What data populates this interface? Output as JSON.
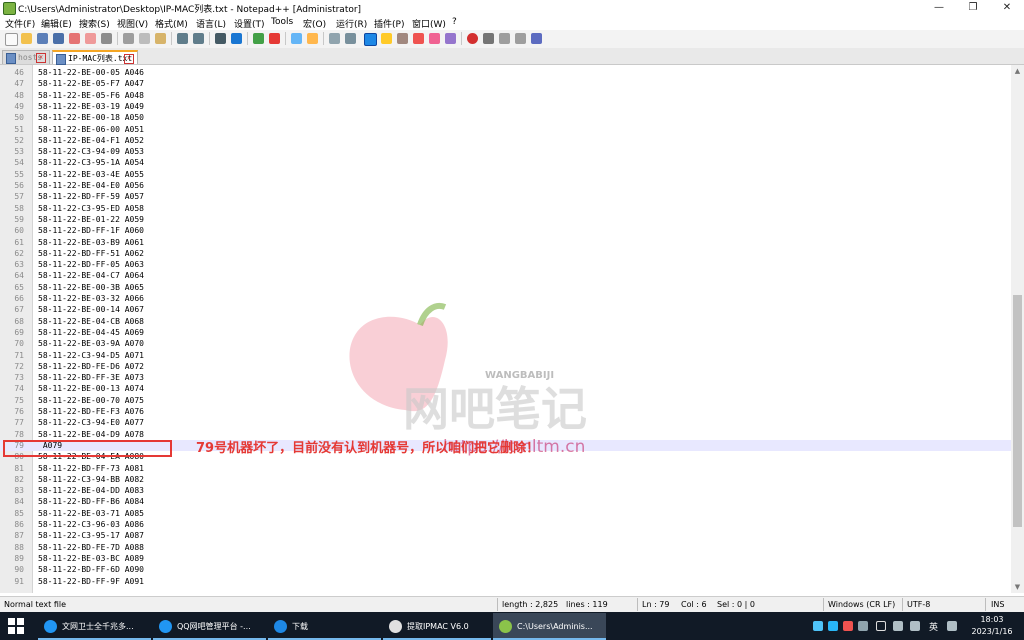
{
  "window": {
    "title": "C:\\Users\\Administrator\\Desktop\\IP-MAC列表.txt - Notepad++ [Administrator]",
    "minimize": "—",
    "maximize": "❐",
    "close": "✕"
  },
  "menu": [
    "文件(F)",
    "编辑(E)",
    "搜索(S)",
    "视图(V)",
    "格式(M)",
    "语言(L)",
    "设置(T)",
    "Tools",
    "宏(O)",
    "运行(R)",
    "插件(P)",
    "窗口(W)",
    "?"
  ],
  "tabs": [
    {
      "label": "hosts"
    },
    {
      "label": "IP-MAC列表.txt"
    }
  ],
  "editor": {
    "lines": [
      {
        "n": "46",
        "text": "58-11-22-BE-00-05 A046"
      },
      {
        "n": "47",
        "text": "58-11-22-BE-05-F7 A047"
      },
      {
        "n": "48",
        "text": "58-11-22-BE-05-F6 A048"
      },
      {
        "n": "49",
        "text": "58-11-22-BE-03-19 A049"
      },
      {
        "n": "50",
        "text": "58-11-22-BE-00-18 A050"
      },
      {
        "n": "51",
        "text": "58-11-22-BE-06-00 A051"
      },
      {
        "n": "52",
        "text": "58-11-22-BE-04-F1 A052"
      },
      {
        "n": "53",
        "text": "58-11-22-C3-94-09 A053"
      },
      {
        "n": "54",
        "text": "58-11-22-C3-95-1A A054"
      },
      {
        "n": "55",
        "text": "58-11-22-BE-03-4E A055"
      },
      {
        "n": "56",
        "text": "58-11-22-BE-04-E0 A056"
      },
      {
        "n": "57",
        "text": "58-11-22-BD-FF-59 A057"
      },
      {
        "n": "58",
        "text": "58-11-22-C3-95-ED A058"
      },
      {
        "n": "59",
        "text": "58-11-22-BE-01-22 A059"
      },
      {
        "n": "60",
        "text": "58-11-22-BD-FF-1F A060"
      },
      {
        "n": "61",
        "text": "58-11-22-BE-03-B9 A061"
      },
      {
        "n": "62",
        "text": "58-11-22-BD-FF-51 A062"
      },
      {
        "n": "63",
        "text": "58-11-22-BD-FF-05 A063"
      },
      {
        "n": "64",
        "text": "58-11-22-BE-04-C7 A064"
      },
      {
        "n": "65",
        "text": "58-11-22-BE-00-3B A065"
      },
      {
        "n": "66",
        "text": "58-11-22-BE-03-32 A066"
      },
      {
        "n": "67",
        "text": "58-11-22-BE-00-14 A067"
      },
      {
        "n": "68",
        "text": "58-11-22-BE-04-CB A068"
      },
      {
        "n": "69",
        "text": "58-11-22-BE-04-45 A069"
      },
      {
        "n": "70",
        "text": "58-11-22-BE-03-9A A070"
      },
      {
        "n": "71",
        "text": "58-11-22-C3-94-D5 A071"
      },
      {
        "n": "72",
        "text": "58-11-22-BD-FE-D6 A072"
      },
      {
        "n": "73",
        "text": "58-11-22-BD-FF-3E A073"
      },
      {
        "n": "74",
        "text": "58-11-22-BE-00-13 A074"
      },
      {
        "n": "75",
        "text": "58-11-22-BE-00-70 A075"
      },
      {
        "n": "76",
        "text": "58-11-22-BD-FE-F3 A076"
      },
      {
        "n": "77",
        "text": "58-11-22-C3-94-E0 A077"
      },
      {
        "n": "78",
        "text": "58-11-22-BE-04-D9 A078"
      },
      {
        "n": "79",
        "text": " A079"
      },
      {
        "n": "80",
        "text": "58-11-22-BE-04-EA A080"
      },
      {
        "n": "81",
        "text": "58-11-22-BD-FF-73 A081"
      },
      {
        "n": "82",
        "text": "58-11-22-C3-94-BB A082"
      },
      {
        "n": "83",
        "text": "58-11-22-BE-04-DD A083"
      },
      {
        "n": "84",
        "text": "58-11-22-BD-FF-B6 A084"
      },
      {
        "n": "85",
        "text": "58-11-22-BE-03-71 A085"
      },
      {
        "n": "86",
        "text": "58-11-22-C3-96-03 A086"
      },
      {
        "n": "87",
        "text": "58-11-22-C3-95-17 A087"
      },
      {
        "n": "88",
        "text": "58-11-22-BD-FE-7D A088"
      },
      {
        "n": "89",
        "text": "58-11-22-BE-03-BC A089"
      },
      {
        "n": "90",
        "text": "58-11-22-BD-FF-6D A090"
      },
      {
        "n": "91",
        "text": "58-11-22-BD-FF-9F A091"
      }
    ],
    "current_line_index": 33
  },
  "annotation": {
    "text": "79号机器坏了，目前没有认到机器号，所以咱们把它删除！",
    "color": "#e53935"
  },
  "watermark": {
    "brand_en": "WANGBABIJI",
    "brand_cn": "网吧笔记",
    "url": "https://ltmltm.cn"
  },
  "status": {
    "filetype": "Normal text file",
    "length": "length : 2,825",
    "lines": "lines : 119",
    "ln": "Ln : 79",
    "col": "Col : 6",
    "sel": "Sel : 0 | 0",
    "eol": "Windows (CR LF)",
    "encoding": "UTF-8",
    "mode": "INS"
  },
  "taskbar": {
    "items": [
      {
        "label": "文网卫士全千兆多...",
        "color": "#2196f3"
      },
      {
        "label": "QQ网吧管理平台 -...",
        "color": "#2196f3"
      },
      {
        "label": "下载",
        "color": "#1e88e5"
      },
      {
        "label": "提取IPMAC V6.0",
        "color": "#e0e0e0"
      },
      {
        "label": "C:\\Users\\Adminis...",
        "color": "#8bc34a"
      }
    ],
    "ime": "英",
    "time": "18:03",
    "date": "2023/1/16"
  }
}
